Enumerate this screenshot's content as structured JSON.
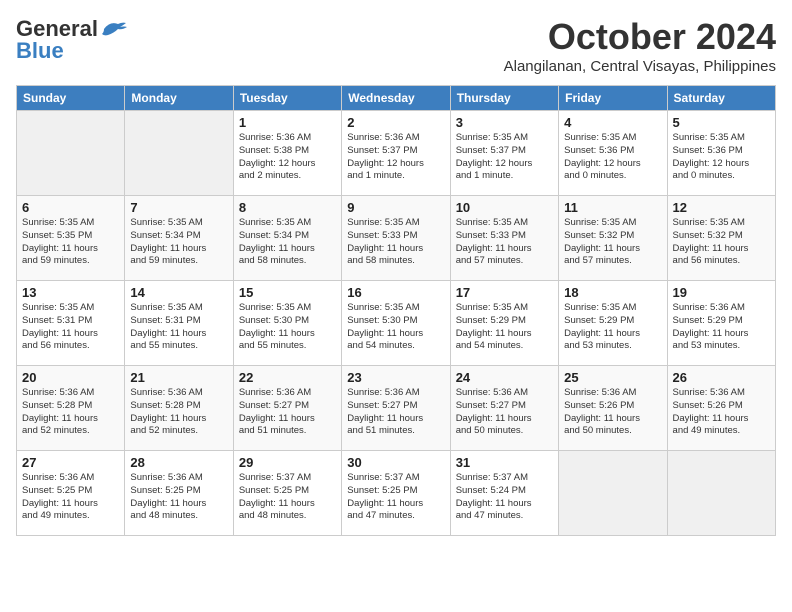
{
  "header": {
    "logo_general": "General",
    "logo_blue": "Blue",
    "month": "October 2024",
    "location": "Alangilanan, Central Visayas, Philippines"
  },
  "weekdays": [
    "Sunday",
    "Monday",
    "Tuesday",
    "Wednesday",
    "Thursday",
    "Friday",
    "Saturday"
  ],
  "weeks": [
    [
      {
        "day": "",
        "info": ""
      },
      {
        "day": "",
        "info": ""
      },
      {
        "day": "1",
        "info": "Sunrise: 5:36 AM\nSunset: 5:38 PM\nDaylight: 12 hours\nand 2 minutes."
      },
      {
        "day": "2",
        "info": "Sunrise: 5:36 AM\nSunset: 5:37 PM\nDaylight: 12 hours\nand 1 minute."
      },
      {
        "day": "3",
        "info": "Sunrise: 5:35 AM\nSunset: 5:37 PM\nDaylight: 12 hours\nand 1 minute."
      },
      {
        "day": "4",
        "info": "Sunrise: 5:35 AM\nSunset: 5:36 PM\nDaylight: 12 hours\nand 0 minutes."
      },
      {
        "day": "5",
        "info": "Sunrise: 5:35 AM\nSunset: 5:36 PM\nDaylight: 12 hours\nand 0 minutes."
      }
    ],
    [
      {
        "day": "6",
        "info": "Sunrise: 5:35 AM\nSunset: 5:35 PM\nDaylight: 11 hours\nand 59 minutes."
      },
      {
        "day": "7",
        "info": "Sunrise: 5:35 AM\nSunset: 5:34 PM\nDaylight: 11 hours\nand 59 minutes."
      },
      {
        "day": "8",
        "info": "Sunrise: 5:35 AM\nSunset: 5:34 PM\nDaylight: 11 hours\nand 58 minutes."
      },
      {
        "day": "9",
        "info": "Sunrise: 5:35 AM\nSunset: 5:33 PM\nDaylight: 11 hours\nand 58 minutes."
      },
      {
        "day": "10",
        "info": "Sunrise: 5:35 AM\nSunset: 5:33 PM\nDaylight: 11 hours\nand 57 minutes."
      },
      {
        "day": "11",
        "info": "Sunrise: 5:35 AM\nSunset: 5:32 PM\nDaylight: 11 hours\nand 57 minutes."
      },
      {
        "day": "12",
        "info": "Sunrise: 5:35 AM\nSunset: 5:32 PM\nDaylight: 11 hours\nand 56 minutes."
      }
    ],
    [
      {
        "day": "13",
        "info": "Sunrise: 5:35 AM\nSunset: 5:31 PM\nDaylight: 11 hours\nand 56 minutes."
      },
      {
        "day": "14",
        "info": "Sunrise: 5:35 AM\nSunset: 5:31 PM\nDaylight: 11 hours\nand 55 minutes."
      },
      {
        "day": "15",
        "info": "Sunrise: 5:35 AM\nSunset: 5:30 PM\nDaylight: 11 hours\nand 55 minutes."
      },
      {
        "day": "16",
        "info": "Sunrise: 5:35 AM\nSunset: 5:30 PM\nDaylight: 11 hours\nand 54 minutes."
      },
      {
        "day": "17",
        "info": "Sunrise: 5:35 AM\nSunset: 5:29 PM\nDaylight: 11 hours\nand 54 minutes."
      },
      {
        "day": "18",
        "info": "Sunrise: 5:35 AM\nSunset: 5:29 PM\nDaylight: 11 hours\nand 53 minutes."
      },
      {
        "day": "19",
        "info": "Sunrise: 5:36 AM\nSunset: 5:29 PM\nDaylight: 11 hours\nand 53 minutes."
      }
    ],
    [
      {
        "day": "20",
        "info": "Sunrise: 5:36 AM\nSunset: 5:28 PM\nDaylight: 11 hours\nand 52 minutes."
      },
      {
        "day": "21",
        "info": "Sunrise: 5:36 AM\nSunset: 5:28 PM\nDaylight: 11 hours\nand 52 minutes."
      },
      {
        "day": "22",
        "info": "Sunrise: 5:36 AM\nSunset: 5:27 PM\nDaylight: 11 hours\nand 51 minutes."
      },
      {
        "day": "23",
        "info": "Sunrise: 5:36 AM\nSunset: 5:27 PM\nDaylight: 11 hours\nand 51 minutes."
      },
      {
        "day": "24",
        "info": "Sunrise: 5:36 AM\nSunset: 5:27 PM\nDaylight: 11 hours\nand 50 minutes."
      },
      {
        "day": "25",
        "info": "Sunrise: 5:36 AM\nSunset: 5:26 PM\nDaylight: 11 hours\nand 50 minutes."
      },
      {
        "day": "26",
        "info": "Sunrise: 5:36 AM\nSunset: 5:26 PM\nDaylight: 11 hours\nand 49 minutes."
      }
    ],
    [
      {
        "day": "27",
        "info": "Sunrise: 5:36 AM\nSunset: 5:25 PM\nDaylight: 11 hours\nand 49 minutes."
      },
      {
        "day": "28",
        "info": "Sunrise: 5:36 AM\nSunset: 5:25 PM\nDaylight: 11 hours\nand 48 minutes."
      },
      {
        "day": "29",
        "info": "Sunrise: 5:37 AM\nSunset: 5:25 PM\nDaylight: 11 hours\nand 48 minutes."
      },
      {
        "day": "30",
        "info": "Sunrise: 5:37 AM\nSunset: 5:25 PM\nDaylight: 11 hours\nand 47 minutes."
      },
      {
        "day": "31",
        "info": "Sunrise: 5:37 AM\nSunset: 5:24 PM\nDaylight: 11 hours\nand 47 minutes."
      },
      {
        "day": "",
        "info": ""
      },
      {
        "day": "",
        "info": ""
      }
    ]
  ]
}
